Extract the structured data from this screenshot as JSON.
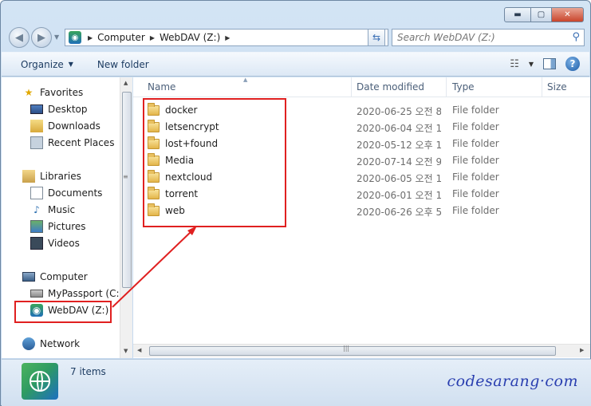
{
  "window": {
    "min_glyph": "▬",
    "max_glyph": "▢",
    "close_glyph": "✕"
  },
  "address": {
    "crumbs": [
      "Computer",
      "WebDAV (Z:)"
    ],
    "search_placeholder": "Search WebDAV (Z:)"
  },
  "toolbar": {
    "organize_label": "Organize",
    "new_folder_label": "New folder",
    "help_label": "?"
  },
  "nav": {
    "favorites": {
      "label": "Favorites",
      "items": [
        "Desktop",
        "Downloads",
        "Recent Places"
      ]
    },
    "libraries": {
      "label": "Libraries",
      "items": [
        "Documents",
        "Music",
        "Pictures",
        "Videos"
      ]
    },
    "computer": {
      "label": "Computer",
      "items": [
        "MyPassport (C:)",
        "WebDAV (Z:)"
      ]
    },
    "network": {
      "label": "Network"
    }
  },
  "columns": {
    "name": "Name",
    "date": "Date modified",
    "type": "Type",
    "size": "Size"
  },
  "files": [
    {
      "name": "docker",
      "date": "2020-06-25 오전 8:...",
      "type": "File folder"
    },
    {
      "name": "letsencrypt",
      "date": "2020-06-04 오전 1...",
      "type": "File folder"
    },
    {
      "name": "lost+found",
      "date": "2020-05-12 오후 1:...",
      "type": "File folder"
    },
    {
      "name": "Media",
      "date": "2020-07-14 오전 9:...",
      "type": "File folder"
    },
    {
      "name": "nextcloud",
      "date": "2020-06-05 오전 1...",
      "type": "File folder"
    },
    {
      "name": "torrent",
      "date": "2020-06-01 오전 1...",
      "type": "File folder"
    },
    {
      "name": "web",
      "date": "2020-06-26 오후 5:...",
      "type": "File folder"
    }
  ],
  "status": {
    "item_count": "7 items",
    "watermark": "codesarang·com"
  },
  "colors": {
    "annotation": "#e02020",
    "watermark": "#2a3fb0"
  }
}
